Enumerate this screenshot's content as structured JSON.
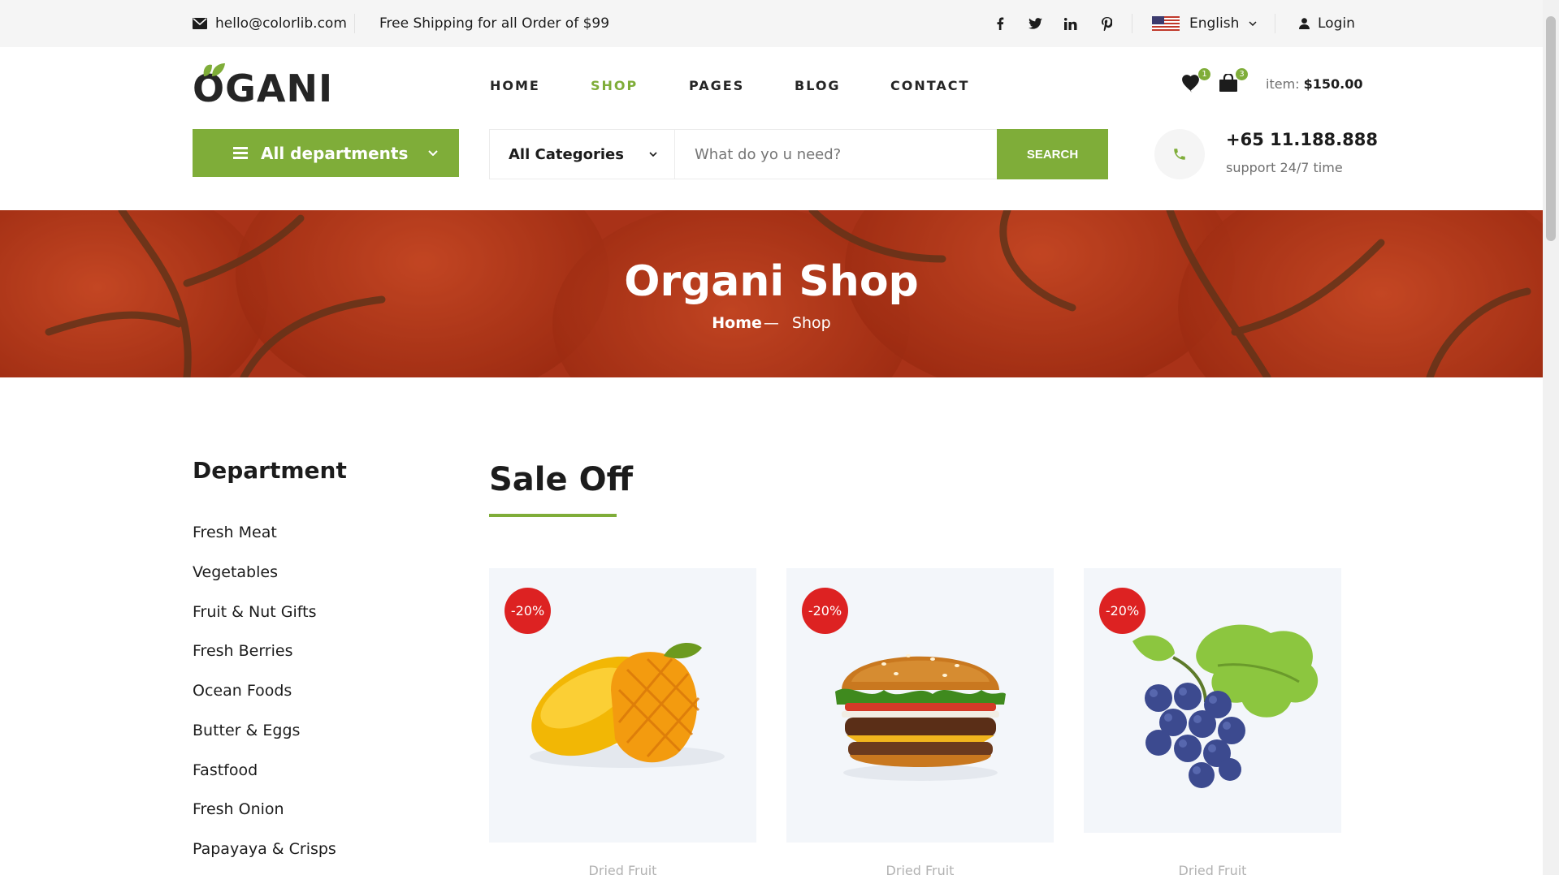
{
  "topbar": {
    "email": "hello@colorlib.com",
    "shipping": "Free Shipping for all Order of $99",
    "language": "English",
    "login": "Login"
  },
  "header": {
    "logo": "OGANI",
    "nav": [
      "HOME",
      "SHOP",
      "PAGES",
      "BLOG",
      "CONTACT"
    ],
    "wishlist_count": "1",
    "cart_count": "3",
    "item_label": "item:",
    "item_total": "$150.00"
  },
  "hero": {
    "departments_label": "All departments",
    "category_selected": "All Categories",
    "search_placeholder": "What do yo u need?",
    "search_button": "SEARCH",
    "phone": "+65 11.188.888",
    "support": "support 24/7 time"
  },
  "banner": {
    "title": "Organi Shop",
    "crumb_home": "Home",
    "crumb_sep": "—",
    "crumb_current": "Shop"
  },
  "sidebar": {
    "title": "Department",
    "items": [
      "Fresh Meat",
      "Vegetables",
      "Fruit & Nut Gifts",
      "Fresh Berries",
      "Ocean Foods",
      "Butter & Eggs",
      "Fastfood",
      "Fresh Onion",
      "Papayaya & Crisps"
    ]
  },
  "sale": {
    "title": "Sale Off",
    "products": [
      {
        "discount": "-20%",
        "category": "Dried Fruit"
      },
      {
        "discount": "-20%",
        "category": "Dried Fruit"
      },
      {
        "discount": "-20%",
        "category": "Dried Fruit"
      }
    ]
  },
  "colors": {
    "accent": "#7fad39",
    "discount": "#dd2222",
    "topbar": "#f5f5f5"
  }
}
